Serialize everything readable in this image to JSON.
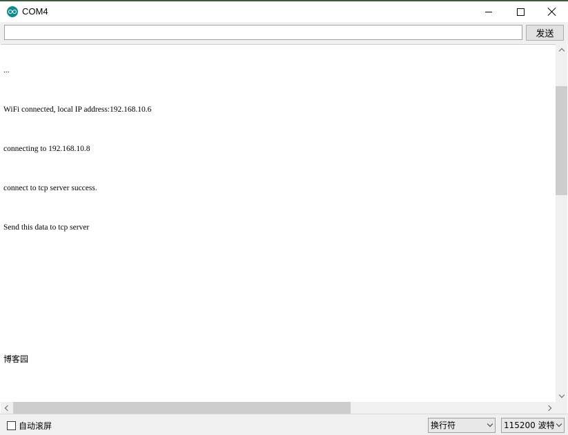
{
  "window": {
    "title": "COM4",
    "minimize_icon": "minimize-icon",
    "maximize_icon": "maximize-icon",
    "close_icon": "close-icon"
  },
  "send_bar": {
    "input_value": "",
    "send_label": "发送"
  },
  "output": {
    "lines": [
      "...",
      "WiFi connected, local IP address:192.168.10.6",
      "connecting to 192.168.10.8",
      "connect to tcp server success.",
      "Send this data to tcp server"
    ],
    "footer_text": "博客园"
  },
  "status_bar": {
    "autoscroll_label": "自动滚屏",
    "autoscroll_checked": false,
    "line_ending": "换行符",
    "baud_rate": "115200 波特"
  }
}
